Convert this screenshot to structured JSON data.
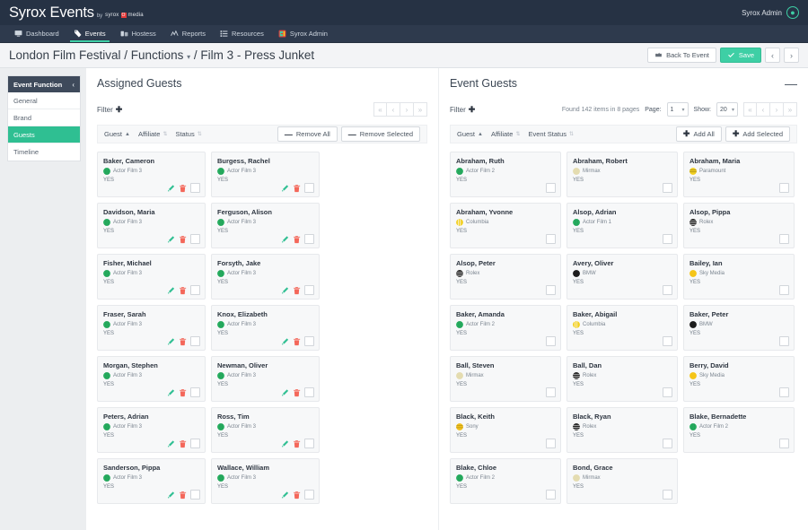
{
  "topbar": {
    "brand_name": "Syrox Events",
    "brand_by": "by",
    "brand_logo_pre": "syrox",
    "brand_logo_mark": "O",
    "brand_logo_post": "media",
    "user_name": "Syrox Admin"
  },
  "nav": {
    "items": [
      {
        "label": "Dashboard",
        "icon": "monitor-icon",
        "active": false
      },
      {
        "label": "Events",
        "icon": "tag-icon",
        "active": true
      },
      {
        "label": "Hostess",
        "icon": "people-icon",
        "active": false
      },
      {
        "label": "Reports",
        "icon": "chart-line-icon",
        "active": false
      },
      {
        "label": "Resources",
        "icon": "list-icon",
        "active": false
      },
      {
        "label": "Syrox Admin",
        "icon": "admin-app-icon",
        "active": false
      }
    ]
  },
  "pagehead": {
    "title_part1": "London Film Festival / Functions",
    "title_caret": "▾",
    "title_part2": "/ Film 3 - Press Junket",
    "back_label": "Back To Event",
    "save_label": "Save",
    "prev_label": "‹",
    "next_label": "›"
  },
  "sidebar": {
    "header": "Event Function",
    "collapse_icon": "‹",
    "items": [
      {
        "label": "General",
        "active": false
      },
      {
        "label": "Brand",
        "active": false
      },
      {
        "label": "Guests",
        "active": true
      },
      {
        "label": "Timeline",
        "active": false
      }
    ]
  },
  "assigned": {
    "title": "Assigned Guests",
    "filter_label": "Filter",
    "filter_plus": "✚",
    "pager": [
      "«",
      "‹",
      "›",
      "»"
    ],
    "sort": [
      {
        "label": "Guest",
        "arrow": "▲",
        "dim": false
      },
      {
        "label": "Affiliate",
        "arrow": "⇅",
        "dim": true
      },
      {
        "label": "Status",
        "arrow": "⇅",
        "dim": true
      }
    ],
    "remove_all": "Remove All",
    "remove_selected": "Remove Selected",
    "minus": "—",
    "guests": [
      {
        "name": "Baker, Cameron",
        "affiliate": "Actor Film 3",
        "status": "YES",
        "icon": "affiliate-actor-film-3"
      },
      {
        "name": "Burgess, Rachel",
        "affiliate": "Actor Film 3",
        "status": "YES",
        "icon": "affiliate-actor-film-3"
      },
      {
        "name": "Davidson, Maria",
        "affiliate": "Actor Film 3",
        "status": "YES",
        "icon": "affiliate-actor-film-3"
      },
      {
        "name": "Ferguson, Alison",
        "affiliate": "Actor Film 3",
        "status": "YES",
        "icon": "affiliate-actor-film-3"
      },
      {
        "name": "Fisher, Michael",
        "affiliate": "Actor Film 3",
        "status": "YES",
        "icon": "affiliate-actor-film-3"
      },
      {
        "name": "Forsyth, Jake",
        "affiliate": "Actor Film 3",
        "status": "YES",
        "icon": "affiliate-actor-film-3"
      },
      {
        "name": "Fraser, Sarah",
        "affiliate": "Actor Film 3",
        "status": "YES",
        "icon": "affiliate-actor-film-3"
      },
      {
        "name": "Knox, Elizabeth",
        "affiliate": "Actor Film 3",
        "status": "YES",
        "icon": "affiliate-actor-film-3"
      },
      {
        "name": "Morgan, Stephen",
        "affiliate": "Actor Film 3",
        "status": "YES",
        "icon": "affiliate-actor-film-3"
      },
      {
        "name": "Newman, Oliver",
        "affiliate": "Actor Film 3",
        "status": "YES",
        "icon": "affiliate-actor-film-3"
      },
      {
        "name": "Peters, Adrian",
        "affiliate": "Actor Film 3",
        "status": "YES",
        "icon": "affiliate-actor-film-3"
      },
      {
        "name": "Ross, Tim",
        "affiliate": "Actor Film 3",
        "status": "YES",
        "icon": "affiliate-actor-film-3"
      },
      {
        "name": "Sanderson, Pippa",
        "affiliate": "Actor Film 3",
        "status": "YES",
        "icon": "affiliate-actor-film-3"
      },
      {
        "name": "Wallace, William",
        "affiliate": "Actor Film 3",
        "status": "YES",
        "icon": "affiliate-actor-film-3"
      }
    ]
  },
  "event_guests": {
    "title": "Event Guests",
    "collapse_icon": "—",
    "filter_label": "Filter",
    "filter_plus": "✚",
    "found_text": "Found 142 items in 8 pages",
    "page_label": "Page:",
    "page_value": "1",
    "show_label": "Show:",
    "show_value": "20",
    "caret": "▾",
    "pager": [
      "«",
      "‹",
      "›",
      "»"
    ],
    "sort": [
      {
        "label": "Guest",
        "arrow": "▲",
        "dim": false
      },
      {
        "label": "Affiliate",
        "arrow": "⇅",
        "dim": true
      },
      {
        "label": "Event Status",
        "arrow": "⇅",
        "dim": true
      }
    ],
    "add_all": "Add All",
    "add_selected": "Add Selected",
    "plus": "✚",
    "guests": [
      {
        "name": "Abraham, Ruth",
        "affiliate": "Actor Film 2",
        "status": "YES",
        "icon": "affiliate-actor-film-2"
      },
      {
        "name": "Abraham, Robert",
        "affiliate": "Mirmax",
        "status": "YES",
        "icon": "affiliate-mirmax"
      },
      {
        "name": "Abraham, Maria",
        "affiliate": "Paramount",
        "status": "YES",
        "icon": "affiliate-paramount"
      },
      {
        "name": "Abraham, Yvonne",
        "affiliate": "Columbia",
        "status": "YES",
        "icon": "affiliate-columbia"
      },
      {
        "name": "Alsop, Adrian",
        "affiliate": "Actor Film 1",
        "status": "YES",
        "icon": "affiliate-actor-film-1"
      },
      {
        "name": "Alsop, Pippa",
        "affiliate": "Rolex",
        "status": "YES",
        "icon": "affiliate-rolex"
      },
      {
        "name": "Alsop, Peter",
        "affiliate": "Rolex",
        "status": "YES",
        "icon": "affiliate-rolex"
      },
      {
        "name": "Avery, Oliver",
        "affiliate": "BMW",
        "status": "YES",
        "icon": "affiliate-bmw"
      },
      {
        "name": "Bailey, Ian",
        "affiliate": "Sky Media",
        "status": "YES",
        "icon": "affiliate-sky-media"
      },
      {
        "name": "Baker, Amanda",
        "affiliate": "Actor Film 2",
        "status": "YES",
        "icon": "affiliate-actor-film-2"
      },
      {
        "name": "Baker, Abigail",
        "affiliate": "Columbia",
        "status": "YES",
        "icon": "affiliate-columbia"
      },
      {
        "name": "Baker, Peter",
        "affiliate": "BMW",
        "status": "YES",
        "icon": "affiliate-bmw"
      },
      {
        "name": "Ball, Steven",
        "affiliate": "Mirmax",
        "status": "YES",
        "icon": "affiliate-mirmax"
      },
      {
        "name": "Ball, Dan",
        "affiliate": "Rolex",
        "status": "YES",
        "icon": "affiliate-rolex"
      },
      {
        "name": "Berry, David",
        "affiliate": "Sky Media",
        "status": "YES",
        "icon": "affiliate-sky-media"
      },
      {
        "name": "Black, Keith",
        "affiliate": "Sony",
        "status": "YES",
        "icon": "affiliate-sony"
      },
      {
        "name": "Black, Ryan",
        "affiliate": "Rolex",
        "status": "YES",
        "icon": "affiliate-rolex"
      },
      {
        "name": "Blake, Bernadette",
        "affiliate": "Actor Film 2",
        "status": "YES",
        "icon": "affiliate-actor-film-2"
      },
      {
        "name": "Blake, Chloe",
        "affiliate": "Actor Film 2",
        "status": "YES",
        "icon": "affiliate-actor-film-2"
      },
      {
        "name": "Bond, Grace",
        "affiliate": "Mirmax",
        "status": "YES",
        "icon": "affiliate-mirmax"
      }
    ]
  },
  "colors": {
    "topbar_bg": "#263244",
    "nav_bg": "#2e3a4d",
    "accent_green": "#3ecfa5",
    "sidebar_head": "#3e4a5b",
    "active_green": "#2fbf92",
    "edit_green": "#2fbf92",
    "delete_red": "#f4675a",
    "affiliate_actor_film_3": "#27ae60",
    "affiliate_actor_film_2": "#27ae60",
    "affiliate_actor_film_1": "#27ae60",
    "affiliate_mirmax": "#e4dcb0",
    "affiliate_paramount": "#f2d024",
    "affiliate_columbia": "#f2d024",
    "affiliate_rolex": "#1d1d1d",
    "affiliate_bmw": "#1d1d1d",
    "affiliate_sky_media": "#f5c518",
    "affiliate_sony": "#f0c020"
  }
}
